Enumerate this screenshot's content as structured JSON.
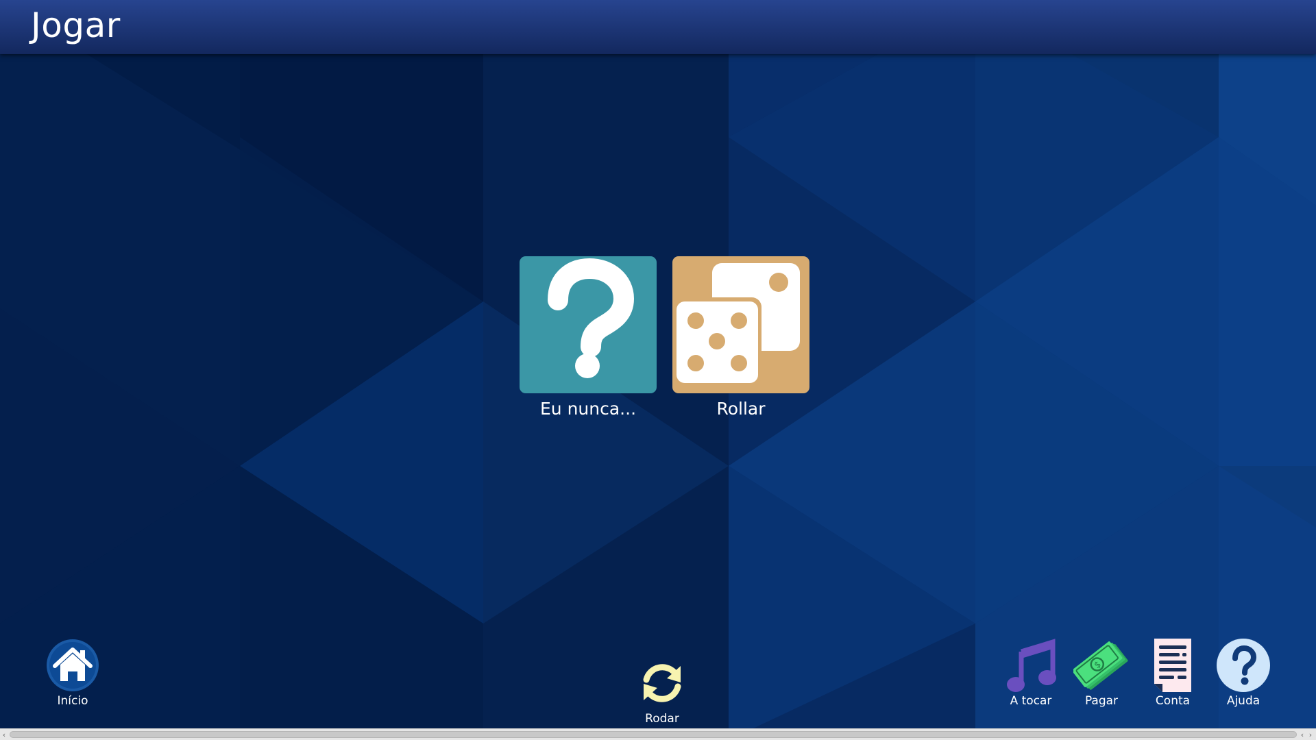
{
  "header": {
    "title": "Jogar"
  },
  "tiles": [
    {
      "label": "Eu nunca...",
      "icon": "question-mark-icon",
      "color": "#3b97a6"
    },
    {
      "label": "Rollar",
      "icon": "dice-icon",
      "color": "#d7ab70"
    }
  ],
  "bottom_bar": {
    "home": {
      "label": "Início",
      "icon": "house-icon"
    },
    "rotate": {
      "label": "Rodar",
      "icon": "rotate-arrows-icon"
    },
    "playing": {
      "label": "A tocar",
      "icon": "music-note-icon"
    },
    "pay": {
      "label": "Pagar",
      "icon": "money-icon"
    },
    "account": {
      "label": "Conta",
      "icon": "receipt-icon"
    },
    "help": {
      "label": "Ajuda",
      "icon": "help-icon"
    }
  },
  "colors": {
    "header": "#1c3575",
    "background": "#0a2a5e",
    "accent_yellow": "#f7f3b0",
    "music_purple": "#6a4fbf",
    "money_green": "#4be07e"
  }
}
